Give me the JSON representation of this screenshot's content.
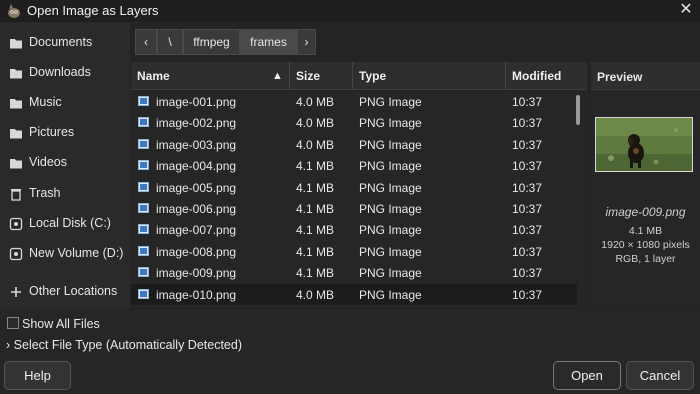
{
  "window": {
    "title": "Open Image as Layers"
  },
  "sidebar": {
    "items": [
      {
        "label": "Documents",
        "icon": "folder-icon"
      },
      {
        "label": "Downloads",
        "icon": "folder-icon"
      },
      {
        "label": "Music",
        "icon": "folder-icon"
      },
      {
        "label": "Pictures",
        "icon": "folder-icon"
      },
      {
        "label": "Videos",
        "icon": "folder-icon"
      },
      {
        "label": "Trash",
        "icon": "trash-icon"
      },
      {
        "label": "Local Disk (C:)",
        "icon": "drive-icon"
      },
      {
        "label": "New Volume (D:)",
        "icon": "drive-icon"
      },
      {
        "label": "Other Locations",
        "icon": "plus-icon"
      }
    ]
  },
  "breadcrumb": {
    "root": "\\",
    "parts": [
      "ffmpeg",
      "frames"
    ]
  },
  "columns": {
    "name": "Name",
    "size": "Size",
    "type": "Type",
    "modified": "Modified"
  },
  "files": [
    {
      "name": "image-001.png",
      "size": "4.0 MB",
      "type": "PNG Image",
      "modified": "10:37"
    },
    {
      "name": "image-002.png",
      "size": "4.0 MB",
      "type": "PNG Image",
      "modified": "10:37"
    },
    {
      "name": "image-003.png",
      "size": "4.0 MB",
      "type": "PNG Image",
      "modified": "10:37"
    },
    {
      "name": "image-004.png",
      "size": "4.1 MB",
      "type": "PNG Image",
      "modified": "10:37"
    },
    {
      "name": "image-005.png",
      "size": "4.1 MB",
      "type": "PNG Image",
      "modified": "10:37"
    },
    {
      "name": "image-006.png",
      "size": "4.1 MB",
      "type": "PNG Image",
      "modified": "10:37"
    },
    {
      "name": "image-007.png",
      "size": "4.1 MB",
      "type": "PNG Image",
      "modified": "10:37"
    },
    {
      "name": "image-008.png",
      "size": "4.1 MB",
      "type": "PNG Image",
      "modified": "10:37"
    },
    {
      "name": "image-009.png",
      "size": "4.1 MB",
      "type": "PNG Image",
      "modified": "10:37"
    },
    {
      "name": "image-010.png",
      "size": "4.0 MB",
      "type": "PNG Image",
      "modified": "10:37"
    }
  ],
  "preview": {
    "header": "Preview",
    "filename": "image-009.png",
    "size": "4.1 MB",
    "dimensions": "1920 × 1080 pixels",
    "mode": "RGB, 1 layer"
  },
  "options": {
    "show_all_files": "Show All Files",
    "file_type": "Select File Type (Automatically Detected)"
  },
  "buttons": {
    "help": "Help",
    "open": "Open",
    "cancel": "Cancel"
  }
}
